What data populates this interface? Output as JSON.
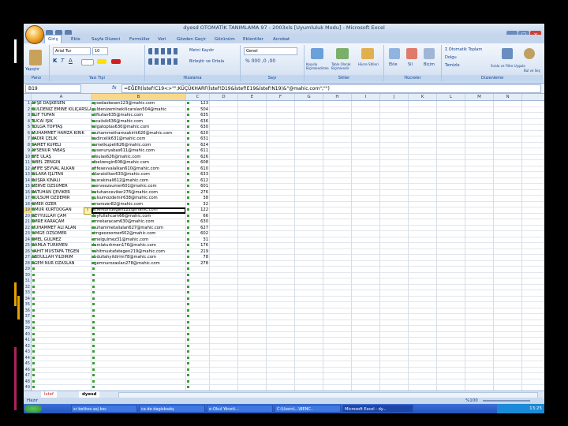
{
  "window": {
    "title": "dyesd OTOMATİK TANIMLAMA 97 - 2003xls [Uyumluluk Modu] - Microsoft Excel",
    "controls": [
      "–",
      "□",
      "×"
    ]
  },
  "tabs": [
    "Giriş",
    "Ekle",
    "Sayfa Düzeni",
    "Formüller",
    "Veri",
    "Gözden Geçir",
    "Görünüm",
    "Eklentiler",
    "Acrobat"
  ],
  "ribbon": {
    "paste_label": "Yapıştır",
    "font_name": "Arial Tur",
    "font_size": "10",
    "wrap_text": "Metni Kaydır",
    "merge_center": "Birleştir ve Ortala",
    "number_format": "Genel",
    "cond_format": "Koşullu Biçimlendirme",
    "format_table": "Tablo Olarak Biçimlendir",
    "cell_styles": "Hücre Stilleri",
    "insert": "Ekle",
    "delete": "Sil",
    "format": "Biçim",
    "autosum": "Otomatik Toplam",
    "fill": "Dolgu",
    "clear": "Temizle",
    "sort_filter": "Sırala ve Filtre Uygula",
    "find_select": "Bul ve Seç",
    "group_labels": [
      "Pano",
      "Yazı Tipi",
      "Hizalama",
      "Sayı",
      "Stiller",
      "Hücreler",
      "Düzenleme"
    ]
  },
  "formula_bar": {
    "name_box": "B19",
    "fx": "fx",
    "formula": "=EĞER(İstef!C19<>\"\";KÜÇÜKHARF(İstef!D19&İstef!E19&İstef!N19)&\"@mahic.com\";\"\")"
  },
  "columns": [
    "A",
    "B",
    "C",
    "D",
    "E",
    "F",
    "G",
    "H",
    "I",
    "J",
    "K",
    "L",
    "M",
    "N"
  ],
  "selected_column": "B",
  "selected_row": 19,
  "rows": [
    {
      "n": 1,
      "a": "AYŞE DAŞKESEN",
      "b": "aysedaskesen123@mahic.com",
      "c": "123"
    },
    {
      "n": 2,
      "a": "GÜLDENİZ EMİNE KILIÇARSLAN",
      "b": "guldenizeminekilicarslan504@mahic",
      "c": "504"
    },
    {
      "n": 3,
      "a": "ELİF TUFAN",
      "b": "eliftufan635@mahic.com",
      "c": "635"
    },
    {
      "n": 4,
      "a": "TÜCAİ IŞIK",
      "b": "tucaiisik636@mahic.com",
      "c": "636"
    },
    {
      "n": 5,
      "a": "TOLGA TOPTAŞ",
      "b": "tolgatoptas630@mahic.com",
      "c": "630"
    },
    {
      "n": 6,
      "a": "MUHAMMET HAMZA KIRIK",
      "b": "muhammethamzakirik620@mahic.com",
      "c": "620"
    },
    {
      "n": 7,
      "a": "KADİR ÇELİK",
      "b": "kadircelik631@mahic.com",
      "c": "631"
    },
    {
      "n": 8,
      "a": "SAMET KÜPELİ",
      "b": "sametkupeli626@mahic.com",
      "c": "624"
    },
    {
      "n": 9,
      "a": "AYSENUR YABAŞ",
      "b": "aysenuryabas611@mahic.com",
      "c": "611"
    },
    {
      "n": 10,
      "a": "EFE ULAŞ",
      "b": "efeulas626@mahic.com",
      "c": "626"
    },
    {
      "n": 11,
      "a": "SİBEL ZENGİN",
      "b": "sibelzengin608@mahic.com",
      "c": "608"
    },
    {
      "n": 12,
      "a": "AFİFE ŞEVVAL ALKAN",
      "b": "afifesevvalalkan610@mahic.com",
      "c": "610"
    },
    {
      "n": 13,
      "a": "DİLARA İŞLİTAN",
      "b": "dilaraislitan633@mahic.com",
      "c": "633"
    },
    {
      "n": 14,
      "a": "BUŞRA KINALI",
      "b": "busrakinali612@mahic.com",
      "c": "612"
    },
    {
      "n": 15,
      "a": "MERVE ÖZSUMER",
      "b": "merveozsumer601@mahic.com",
      "c": "601"
    },
    {
      "n": 16,
      "a": "BATUHAN ÇEVİKER",
      "b": "batuhanceviker276@mahic.com",
      "c": "276"
    },
    {
      "n": 17,
      "a": "GÜLSÜM ÖZDEMİR",
      "b": "gulsumozdemir638@mahic.com",
      "c": "38"
    },
    {
      "n": 18,
      "a": "ÖMER ÖZER",
      "b": "omerozer82@mahic.com",
      "c": "32"
    },
    {
      "n": 19,
      "a": "ÖMÜR KURTDOĞAN",
      "b": "omerkurtdogan122@mahic.com",
      "c": "122"
    },
    {
      "n": 20,
      "a": "DEYYULLAH ÇAM",
      "b": "deyfullahcam66@mahic.com",
      "c": "66"
    },
    {
      "n": 21,
      "a": "EMRE KARAÇAM",
      "b": "emrekaracam630@mahic.com",
      "c": "630"
    },
    {
      "n": 22,
      "a": "MUHAMMET ALİ ALAN",
      "b": "muhammetalialan627@mahic.com",
      "c": "627"
    },
    {
      "n": 23,
      "a": "SİMGE ÖZSÖMER",
      "b": "simgeozsomer602@mahic.com",
      "c": "602"
    },
    {
      "n": 24,
      "a": "EMEL GÜLMEZ",
      "b": "emelgulmez31@mahic.com",
      "c": "31"
    },
    {
      "n": 25,
      "a": "DAMLA TÜRKMEN",
      "b": "damlaturkmen176@mahic.com",
      "c": "176"
    },
    {
      "n": 26,
      "a": "VAHİT MUSTAFA TEGEN",
      "b": "vahitmustafategen219@mahic.com",
      "c": "219"
    },
    {
      "n": 27,
      "a": "ABDULLAH YILDIRIM",
      "b": "abdullahyildirim78@mahic.com",
      "c": "78"
    },
    {
      "n": 28,
      "a": "EGEM NUR ÖZASLAN",
      "b": "egemnurozaslan278@mahic.com",
      "c": "278"
    },
    {
      "n": 29,
      "a": "",
      "b": "",
      "c": ""
    },
    {
      "n": 30,
      "a": "",
      "b": "",
      "c": ""
    },
    {
      "n": 31,
      "a": "",
      "b": "",
      "c": ""
    },
    {
      "n": 32,
      "a": "",
      "b": "",
      "c": ""
    },
    {
      "n": 33,
      "a": "",
      "b": "",
      "c": ""
    },
    {
      "n": 34,
      "a": "",
      "b": "",
      "c": ""
    },
    {
      "n": 35,
      "a": "",
      "b": "",
      "c": ""
    },
    {
      "n": 36,
      "a": "",
      "b": "",
      "c": ""
    },
    {
      "n": 37,
      "a": "",
      "b": "",
      "c": ""
    },
    {
      "n": 38,
      "a": "",
      "b": "",
      "c": ""
    },
    {
      "n": 39,
      "a": "",
      "b": "",
      "c": ""
    },
    {
      "n": 40,
      "a": "",
      "b": "",
      "c": ""
    },
    {
      "n": 41,
      "a": "",
      "b": "",
      "c": ""
    },
    {
      "n": 42,
      "a": "",
      "b": "",
      "c": ""
    },
    {
      "n": 43,
      "a": "",
      "b": "",
      "c": ""
    },
    {
      "n": 44,
      "a": "",
      "b": "",
      "c": ""
    },
    {
      "n": 45,
      "a": "",
      "b": "",
      "c": ""
    },
    {
      "n": 46,
      "a": "",
      "b": "",
      "c": ""
    },
    {
      "n": 47,
      "a": "",
      "b": "",
      "c": ""
    },
    {
      "n": 48,
      "a": "",
      "b": "",
      "c": ""
    },
    {
      "n": 49,
      "a": "",
      "b": "",
      "c": ""
    }
  ],
  "sheet_tabs": [
    "İstef",
    "dyesd"
  ],
  "active_sheet": "dyesd",
  "status": {
    "left": "Hazır",
    "zoom": "%100"
  },
  "taskbar": {
    "items": [
      "sr bethos asj bsc",
      "ca de dagisbadq",
      "e-Okul Yöneti...",
      "C:\\Users\\...\\BENC..",
      "Microsoft Excel - dy..."
    ],
    "active_item": 4,
    "clock": "13:25"
  },
  "colors": {
    "accent": "#15428b",
    "selection": "#f8d88a",
    "ribbon": "#dbe6f4",
    "taskbar": "#2555c0"
  }
}
